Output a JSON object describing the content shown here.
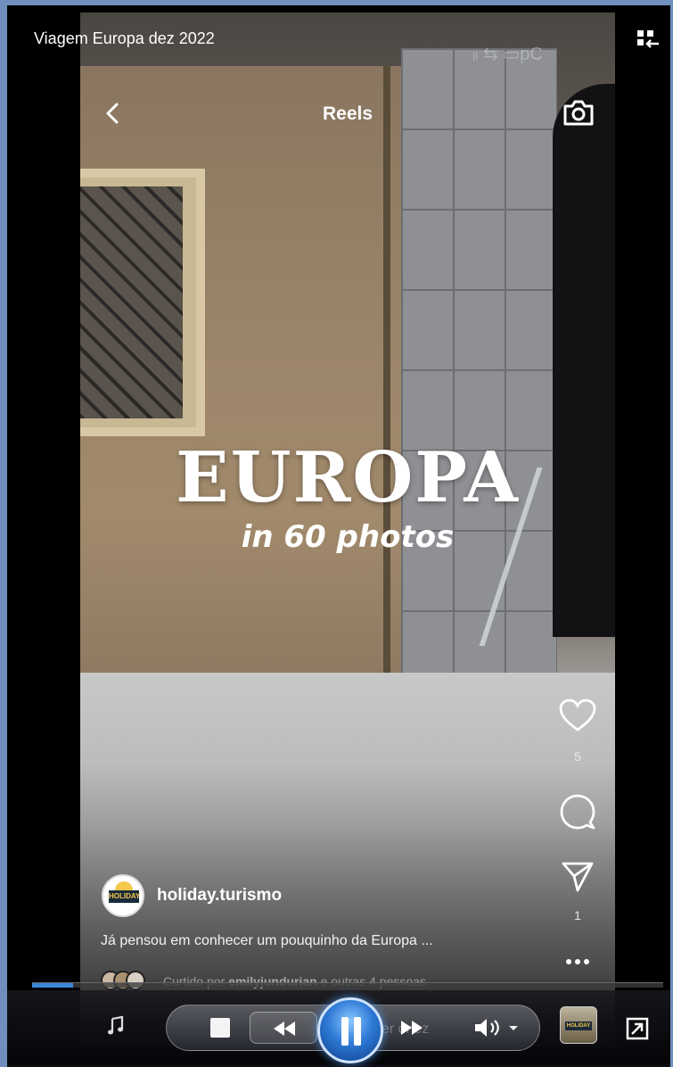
{
  "window": {
    "title": "Viagem Europa dez 2022"
  },
  "header": {
    "title": "Reels",
    "status_text": "ᵢₗ ⇆ ▭pC"
  },
  "overlay": {
    "headline": "EUROPA",
    "subline": "in 60 photos"
  },
  "actions": {
    "likes": "5",
    "shares": "1"
  },
  "post": {
    "author": "holiday.turismo",
    "avatar_text": "HOLIDAY",
    "caption": "Já pensou em conhecer um pouquinho da Europa ...",
    "liked_prefix": "Curtido por",
    "liked_user": "emilyjundurian",
    "liked_suffix": "e outras 4 pessoas"
  },
  "player": {
    "progress_fraction": 0.065,
    "faded_label": "er onez",
    "thumb_text": "HOLIDAY"
  },
  "colors": {
    "accent": "#3a86d6",
    "window_border": "#6f8fbf"
  }
}
